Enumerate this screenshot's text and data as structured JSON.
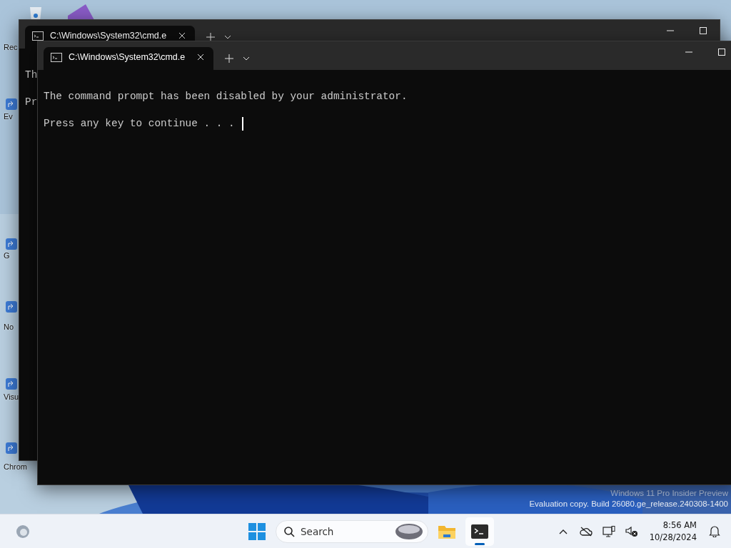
{
  "desktop": {
    "icons": [
      {
        "label": "Rec"
      },
      {
        "label": "Ev"
      },
      {
        "label": "G"
      },
      {
        "label": "No"
      },
      {
        "label": "Visu"
      },
      {
        "label": "Chrom"
      }
    ],
    "watermark": [
      "Windows 11 Pro Insider Preview",
      "Evaluation copy. Build 26080.ge_release.240308-1400"
    ]
  },
  "windows": [
    {
      "tabs": [
        {
          "title": "C:\\Windows\\System32\\cmd.e",
          "selected": true
        }
      ],
      "lines": [
        "Th",
        "Pr"
      ]
    },
    {
      "tabs": [
        {
          "title": "C:\\Windows\\System32\\cmd.e",
          "selected": true
        }
      ],
      "lines": [
        "The command prompt has been disabled by your administrator.",
        "Press any key to continue . . ."
      ],
      "cursor": true
    }
  ],
  "taskbar": {
    "search": {
      "placeholder": "Search"
    },
    "apps": [
      {
        "kind": "explorer",
        "selected": false
      },
      {
        "kind": "terminal",
        "selected": true
      }
    ],
    "clock": {
      "time": "8:56 AM",
      "date": "10/28/2024"
    }
  }
}
